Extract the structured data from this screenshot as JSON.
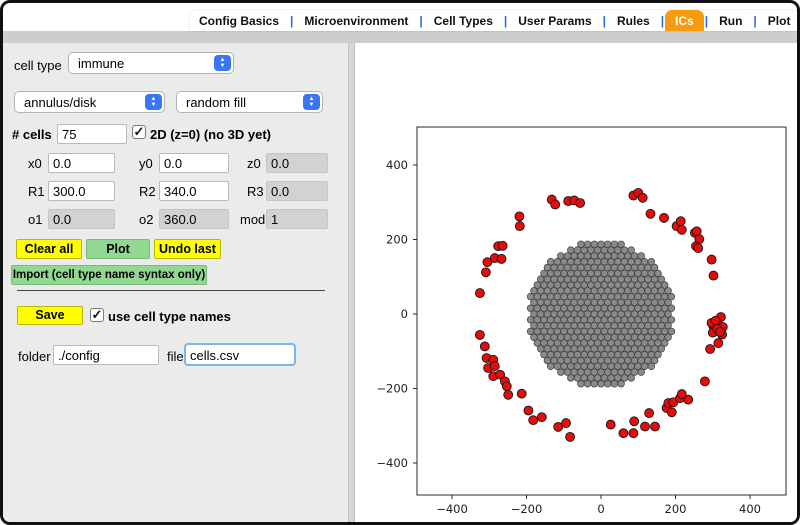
{
  "tabs": {
    "separator": "|",
    "items": [
      {
        "label": "Config Basics",
        "active": false
      },
      {
        "label": "Microenvironment",
        "active": false
      },
      {
        "label": "Cell Types",
        "active": false
      },
      {
        "label": "User Params",
        "active": false
      },
      {
        "label": "Rules",
        "active": false
      },
      {
        "label": "ICs",
        "active": true
      },
      {
        "label": "Run",
        "active": false
      },
      {
        "label": "Plot",
        "active": false
      }
    ]
  },
  "form": {
    "cell_type": {
      "label": "cell type",
      "value": "immune"
    },
    "shape": {
      "value": "annulus/disk"
    },
    "fill": {
      "value": "random fill"
    },
    "num_cells": {
      "label": "# cells",
      "value": "75"
    },
    "dim2": {
      "label": "2D (z=0) (no 3D yet)",
      "checked": true,
      "checkmark": "✓"
    },
    "x0": {
      "label": "x0",
      "value": "0.0",
      "enabled": true
    },
    "y0": {
      "label": "y0",
      "value": "0.0",
      "enabled": true
    },
    "z0": {
      "label": "z0",
      "value": "0.0",
      "enabled": false
    },
    "r1": {
      "label": "R1",
      "value": "300.0",
      "enabled": true
    },
    "r2": {
      "label": "R2",
      "value": "340.0",
      "enabled": true
    },
    "r3": {
      "label": "R3",
      "value": "0.0",
      "enabled": false
    },
    "o1": {
      "label": "o1",
      "value": "0.0",
      "enabled": false
    },
    "o2": {
      "label": "o2",
      "value": "360.0",
      "enabled": false
    },
    "mod": {
      "label": "mod",
      "value": "1",
      "enabled": false
    },
    "buttons": {
      "clear_all": "Clear all",
      "plot": "Plot",
      "undo_last": "Undo last",
      "import": "Import (cell type name syntax only)",
      "save": "Save"
    },
    "use_names": {
      "label": "use cell type names",
      "checked": true,
      "checkmark": "✓"
    },
    "folder": {
      "label": "folder",
      "value": "./config"
    },
    "file": {
      "label": "file",
      "value": "cells.csv"
    }
  },
  "colors": {
    "active_tab_orange": "#f99b0e",
    "tab_separator_blue": "#2a6bd8",
    "combo_spinner_blue": "#3a76f1",
    "button_yellow": "#ffff00",
    "button_green": "#92d893",
    "panel_background": "#ebebeb",
    "disabled_field": "#d2d2d2",
    "focus_ring_blue": "#7ab6ee",
    "tumor_cell_gray": "#8a8a8a",
    "immune_cell_red": "#e60c0c"
  },
  "chart_data": {
    "type": "scatter",
    "title": "",
    "xlabel": "",
    "ylabel": "",
    "xlim": [
      -495,
      497
    ],
    "ylim": [
      -486,
      502
    ],
    "x_ticks": [
      -400,
      -200,
      0,
      200,
      400
    ],
    "y_ticks": [
      400,
      200,
      0,
      -200,
      -400
    ],
    "grid": false,
    "legend": "none",
    "tumor_disk": {
      "center": [
        0,
        0
      ],
      "radius": 200,
      "cell_spacing": 18,
      "cell_radius": 9,
      "fill": "#8a8a8a",
      "edge": "#3c3c3c"
    },
    "immune_cells": {
      "count": 75,
      "annulus_r1": 300,
      "annulus_r2": 340,
      "marker_radius": 12,
      "fill": "#e60c0c",
      "edge": "#151515",
      "points": [
        [
          -132,
          307
        ],
        [
          -123,
          294
        ],
        [
          -88,
          303
        ],
        [
          -72,
          305
        ],
        [
          -56,
          298
        ],
        [
          87,
          318
        ],
        [
          100,
          325
        ],
        [
          112,
          312
        ],
        [
          133,
          269
        ],
        [
          169,
          258
        ],
        [
          203,
          236
        ],
        [
          214,
          249
        ],
        [
          217,
          226
        ],
        [
          252,
          218
        ],
        [
          257,
          222
        ],
        [
          264,
          201
        ],
        [
          255,
          182
        ],
        [
          261,
          177
        ],
        [
          297,
          146
        ],
        [
          302,
          103
        ],
        [
          -219,
          262
        ],
        [
          -218,
          236
        ],
        [
          -276,
          182
        ],
        [
          -264,
          183
        ],
        [
          -305,
          139
        ],
        [
          -285,
          150
        ],
        [
          -267,
          148
        ],
        [
          -309,
          112
        ],
        [
          -325,
          56
        ],
        [
          -325,
          -56
        ],
        [
          -312,
          -87
        ],
        [
          -307,
          -118
        ],
        [
          -289,
          -123
        ],
        [
          -303,
          -145
        ],
        [
          -285,
          -140
        ],
        [
          -289,
          -167
        ],
        [
          -271,
          -163
        ],
        [
          -258,
          -181
        ],
        [
          -253,
          -194
        ],
        [
          -249,
          -217
        ],
        [
          -213,
          -214
        ],
        [
          -195,
          -259
        ],
        [
          -182,
          -285
        ],
        [
          -159,
          -277
        ],
        [
          -115,
          -303
        ],
        [
          -94,
          -293
        ],
        [
          -83,
          -330
        ],
        [
          26,
          -297
        ],
        [
          60,
          -320
        ],
        [
          87,
          -320
        ],
        [
          89,
          -288
        ],
        [
          118,
          -302
        ],
        [
          145,
          -302
        ],
        [
          129,
          -266
        ],
        [
          176,
          -252
        ],
        [
          190,
          -264
        ],
        [
          181,
          -239
        ],
        [
          194,
          -237
        ],
        [
          212,
          -226
        ],
        [
          234,
          -230
        ],
        [
          217,
          -215
        ],
        [
          279,
          -181
        ],
        [
          293,
          -94
        ],
        [
          315,
          -78
        ],
        [
          302,
          -33
        ],
        [
          315,
          -29
        ],
        [
          297,
          -24
        ],
        [
          322,
          -8
        ],
        [
          310,
          -45
        ],
        [
          325,
          -55
        ],
        [
          308,
          -18
        ],
        [
          300,
          -50
        ],
        [
          327,
          -35
        ],
        [
          312,
          -40
        ],
        [
          320,
          -48
        ]
      ]
    }
  }
}
